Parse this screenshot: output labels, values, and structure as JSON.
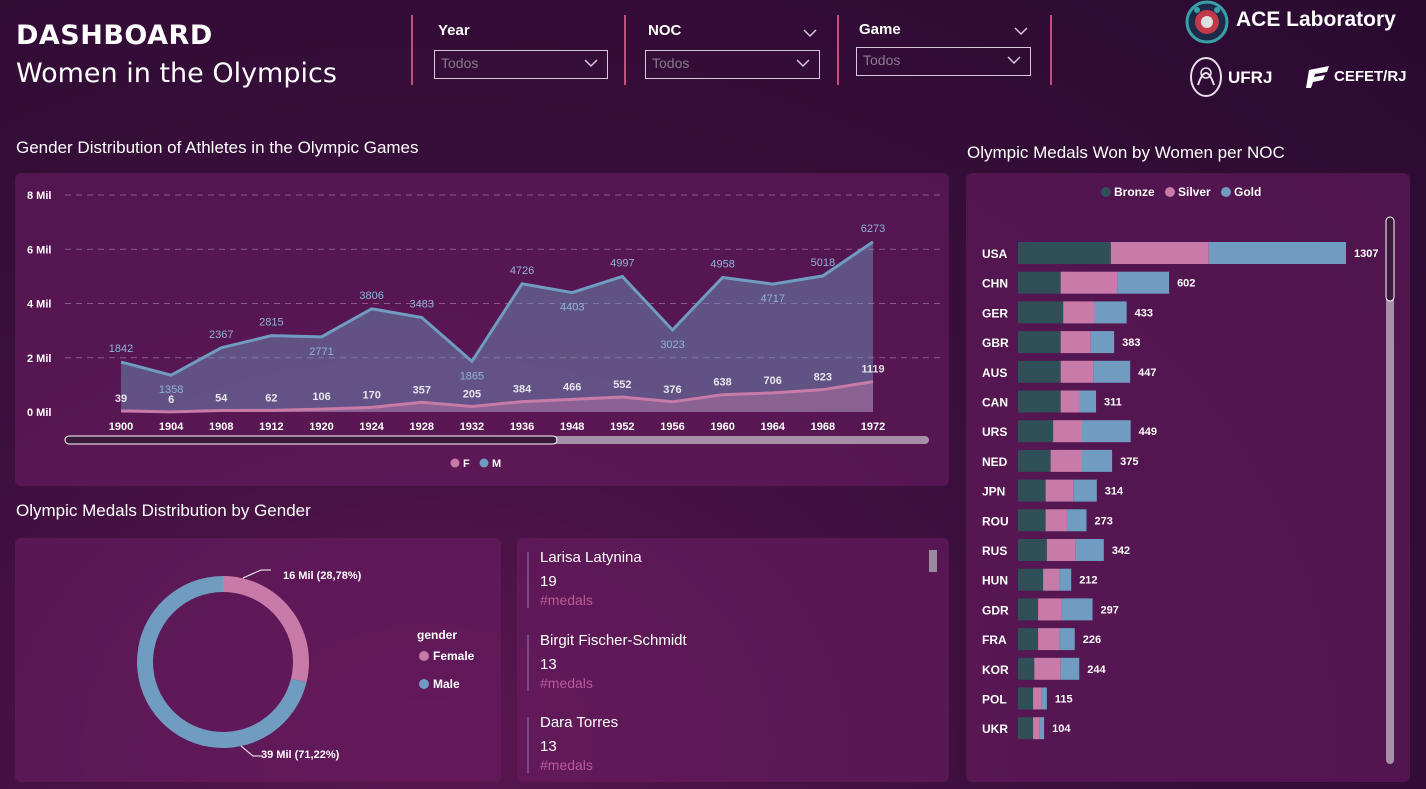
{
  "header": {
    "title": "DASHBOARD",
    "subtitle": "Women in the Olympics"
  },
  "filters": [
    {
      "label": "Year",
      "value": "Todos"
    },
    {
      "label": "NOC",
      "value": "Todos"
    },
    {
      "label": "Game",
      "value": "Todos"
    }
  ],
  "brand": {
    "lab": "ACE Laboratory",
    "ufrj": "UFRJ",
    "cefet": "CEFET/RJ"
  },
  "colors": {
    "female": "#c87aa8",
    "male": "#6f9cc0",
    "bronze": "#2f4f59",
    "silver": "#c87aa8",
    "gold": "#6f9cc0"
  },
  "gender_chart": {
    "title": "Gender Distribution of Athletes in the Olympic Games",
    "chart_data": {
      "type": "area",
      "x": [
        "1900",
        "1904",
        "1908",
        "1912",
        "1920",
        "1924",
        "1928",
        "1932",
        "1936",
        "1948",
        "1952",
        "1956",
        "1960",
        "1964",
        "1968",
        "1972"
      ],
      "series": [
        {
          "name": "F",
          "values": [
            39,
            6,
            54,
            62,
            106,
            170,
            357,
            205,
            384,
            466,
            552,
            376,
            638,
            706,
            823,
            1119
          ]
        },
        {
          "name": "M",
          "values": [
            1842,
            1358,
            2367,
            2815,
            2771,
            3806,
            3483,
            1865,
            4726,
            4403,
            4997,
            3023,
            4958,
            4717,
            5018,
            6273
          ]
        }
      ],
      "yticks": [
        "0 Mil",
        "2 Mil",
        "4 Mil",
        "6 Mil",
        "8 Mil"
      ],
      "ylim": [
        0,
        8000
      ],
      "legend": "bottom-center"
    }
  },
  "medals_gender": {
    "title": "Olympic Medals Distribution by Gender",
    "chart_data": {
      "type": "pie",
      "legend_title": "gender",
      "slices": [
        {
          "name": "Female",
          "value": 28.78,
          "label": "16 Mil (28,78%)"
        },
        {
          "name": "Male",
          "value": 71.22,
          "label": "39 Mil (71,22%)"
        }
      ],
      "legend": "right"
    }
  },
  "top_athletes": [
    {
      "name": "Larisa Latynina",
      "count": "19",
      "unit": "#medals"
    },
    {
      "name": "Birgit Fischer-Schmidt",
      "count": "13",
      "unit": "#medals"
    },
    {
      "name": "Dara Torres",
      "count": "13",
      "unit": "#medals"
    }
  ],
  "medals_noc": {
    "title": "Olympic Medals Won by Women per NOC",
    "legend": [
      "Bronze",
      "Silver",
      "Gold"
    ],
    "chart_data": {
      "type": "bar",
      "orientation": "horizontal-stacked",
      "categories": [
        "USA",
        "CHN",
        "GER",
        "GBR",
        "AUS",
        "CAN",
        "URS",
        "NED",
        "JPN",
        "ROU",
        "RUS",
        "HUN",
        "GDR",
        "FRA",
        "KOR",
        "POL",
        "UKR"
      ],
      "series": [
        {
          "name": "Bronze",
          "values": [
            370,
            170,
            180,
            170,
            170,
            170,
            140,
            130,
            110,
            110,
            115,
            100,
            80,
            80,
            65,
            60,
            60
          ]
        },
        {
          "name": "Silver",
          "values": [
            390,
            225,
            125,
            120,
            130,
            75,
            115,
            125,
            110,
            85,
            115,
            65,
            95,
            85,
            105,
            35,
            25
          ]
        },
        {
          "name": "Gold",
          "values": [
            547,
            207,
            128,
            93,
            147,
            66,
            194,
            120,
            94,
            78,
            112,
            47,
            122,
            61,
            74,
            20,
            19
          ]
        }
      ],
      "totals": [
        1307,
        602,
        433,
        383,
        447,
        311,
        449,
        375,
        314,
        273,
        342,
        212,
        297,
        226,
        244,
        115,
        104
      ],
      "legend": "top-center"
    }
  }
}
